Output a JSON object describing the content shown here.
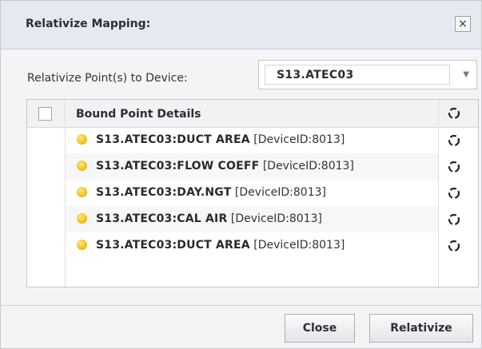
{
  "dialog": {
    "title": "Relativize Mapping:",
    "close_glyph": "×"
  },
  "relativize": {
    "label": "Relativize Point(s) to Device:",
    "selected_device": "S13.ATEC03",
    "dropdown_arrow": "▼"
  },
  "grid": {
    "header": "Bound Point Details",
    "rows": [
      {
        "point": "S13.ATEC03:DUCT AREA",
        "device": "[DeviceID:8013]"
      },
      {
        "point": "S13.ATEC03:FLOW COEFF",
        "device": "[DeviceID:8013]"
      },
      {
        "point": "S13.ATEC03:DAY.NGT",
        "device": "[DeviceID:8013]"
      },
      {
        "point": "S13.ATEC03:CAL AIR",
        "device": "[DeviceID:8013]"
      },
      {
        "point": "S13.ATEC03:DUCT AREA",
        "device": "[DeviceID:8013]"
      }
    ]
  },
  "buttons": {
    "close": "Close",
    "relativize": "Relativize"
  },
  "icons": {
    "status": "yellow-status-dot-icon",
    "refresh": "refresh-icon",
    "close": "close-icon",
    "dropdown": "chevron-down-icon"
  }
}
